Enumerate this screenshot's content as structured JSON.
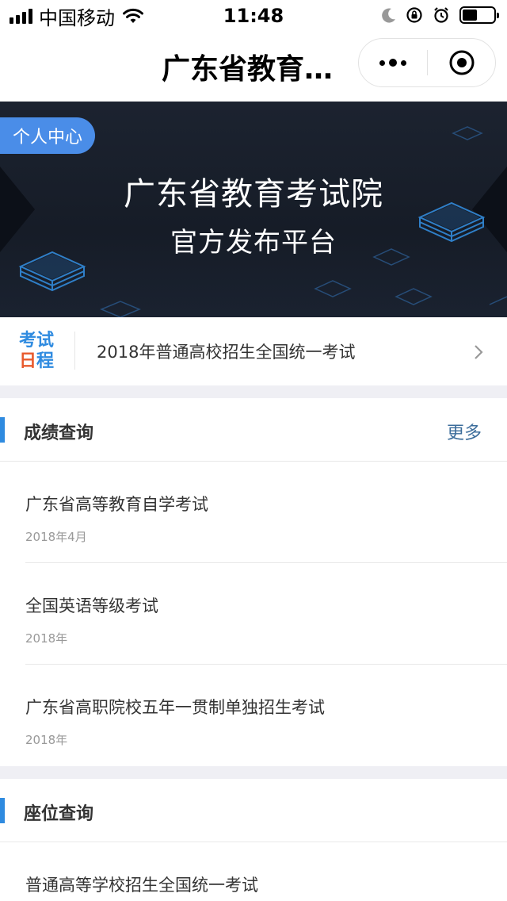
{
  "status_bar": {
    "carrier": "中国移动",
    "time": "11:48"
  },
  "nav": {
    "title": "广东省教育…"
  },
  "banner": {
    "personal_center": "个人中心",
    "title": "广东省教育考试院",
    "subtitle": "官方发布平台"
  },
  "schedule": {
    "logo_line1": "考试",
    "logo_line2_a": "日",
    "logo_line2_b": "程",
    "text": "2018年普通高校招生全国统一考试"
  },
  "score_section": {
    "title": "成绩查询",
    "more": "更多",
    "items": [
      {
        "name": "广东省高等教育自学考试",
        "date": "2018年4月"
      },
      {
        "name": "全国英语等级考试",
        "date": "2018年"
      },
      {
        "name": "广东省高职院校五年一贯制单独招生考试",
        "date": "2018年"
      }
    ]
  },
  "seat_section": {
    "title": "座位查询",
    "items": [
      {
        "name": "普通高等学校招生全国统一考试"
      }
    ]
  },
  "colors": {
    "accent": "#2f8be0",
    "personal_btn": "#4a8de8",
    "banner_bg": "#1a2130",
    "more_link": "#3c6d9b",
    "logo_red": "#e85a2d"
  }
}
